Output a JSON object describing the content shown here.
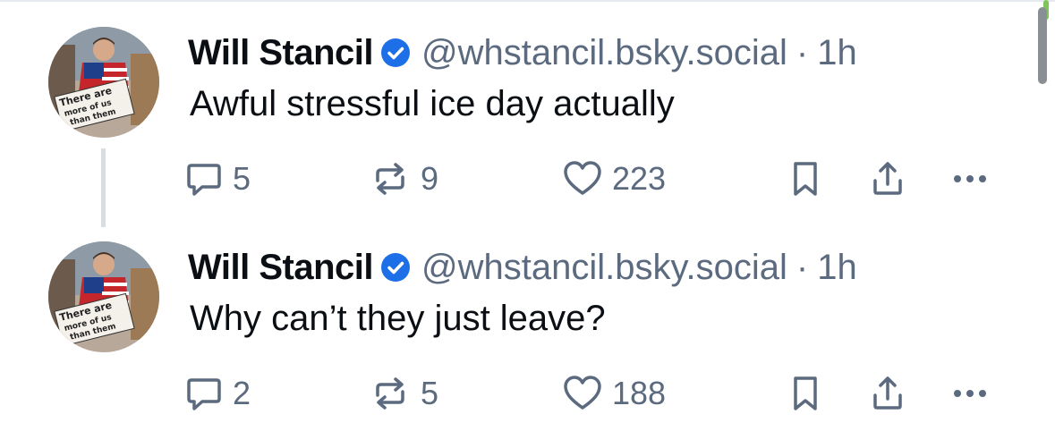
{
  "posts": [
    {
      "author": "Will Stancil",
      "handle": "@whstancil.bsky.social",
      "separator": "·",
      "time": "1h",
      "text": "Awful stressful ice day actually",
      "replies": "5",
      "reposts": "9",
      "likes": "223",
      "avatar_sign": [
        "There are",
        "more of us",
        "than them"
      ]
    },
    {
      "author": "Will Stancil",
      "handle": "@whstancil.bsky.social",
      "separator": "·",
      "time": "1h",
      "text": "Why can’t they just leave?",
      "replies": "2",
      "reposts": "5",
      "likes": "188",
      "avatar_sign": [
        "There are",
        "more of us",
        "than them"
      ]
    }
  ],
  "icons": {
    "verified": "verified-badge-icon",
    "reply": "reply-bubble-icon",
    "repost": "repost-arrows-icon",
    "like": "heart-icon",
    "bookmark": "bookmark-icon",
    "share": "share-icon",
    "more": "more-dots-icon"
  },
  "colors": {
    "text": "#0b0f14",
    "muted": "#5b6a7e",
    "verified": "#1d6fe8",
    "thread_line": "#d7dde5"
  }
}
